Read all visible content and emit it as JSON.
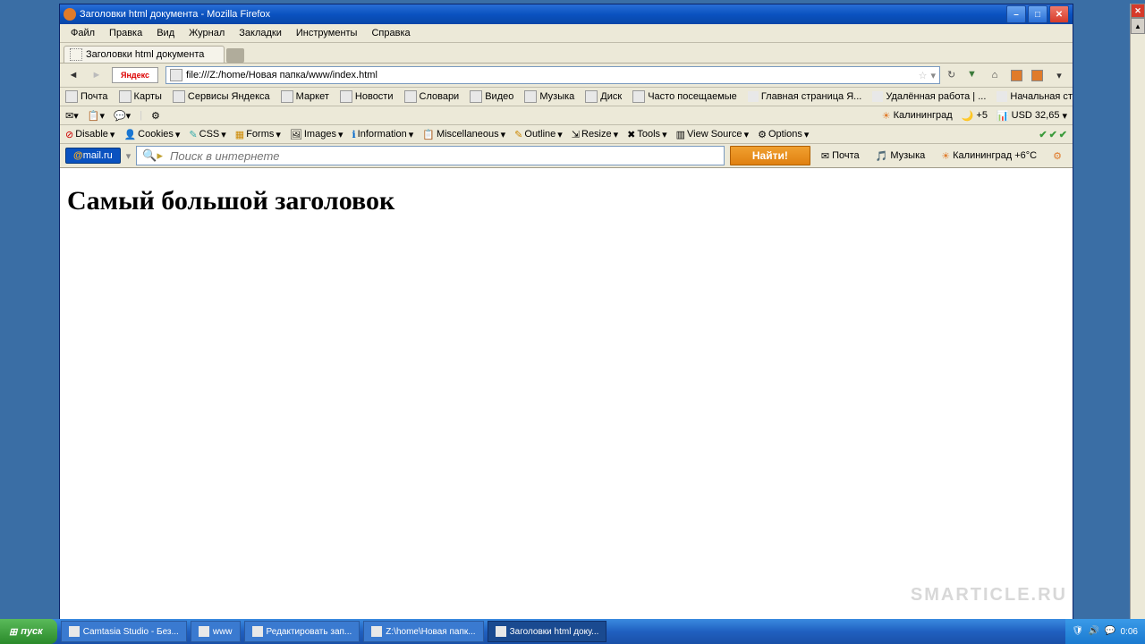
{
  "title": "Заголовки html документа - Mozilla Firefox",
  "menu": [
    "Файл",
    "Правка",
    "Вид",
    "Журнал",
    "Закладки",
    "Инструменты",
    "Справка"
  ],
  "tab": "Заголовки html документа",
  "url": "file:///Z:/home/Новая папка/www/index.html",
  "yandex": "Яндекс",
  "bookmarks": [
    "Почта",
    "Карты",
    "Сервисы Яндекса",
    "Маркет",
    "Новости",
    "Словари",
    "Видео",
    "Музыка",
    "Диск",
    "Часто посещаемые",
    "Главная страница Я...",
    "Удалённая работа | ...",
    "Начальная страница"
  ],
  "tool2": {
    "city": "Калининград",
    "temp": "+5",
    "usd": "USD 32,65"
  },
  "webdev": [
    "Disable",
    "Cookies",
    "CSS",
    "Forms",
    "Images",
    "Information",
    "Miscellaneous",
    "Outline",
    "Resize",
    "Tools",
    "View Source",
    "Options"
  ],
  "mailru": "@mail.ru",
  "search_ph": "Поиск в интернете",
  "find": "Найти!",
  "mail_links": {
    "mail": "Почта",
    "music": "Музыка",
    "weather": "Калининград +6°C"
  },
  "heading": "Самый большой заголовок",
  "watermark": "SMARTICLE.RU",
  "start": "пуск",
  "tasks": [
    "Camtasia Studio - Без...",
    "www",
    "Редактировать зап...",
    "Z:\\home\\Новая папк...",
    "Заголовки html доку..."
  ],
  "tray_time": "0:06"
}
